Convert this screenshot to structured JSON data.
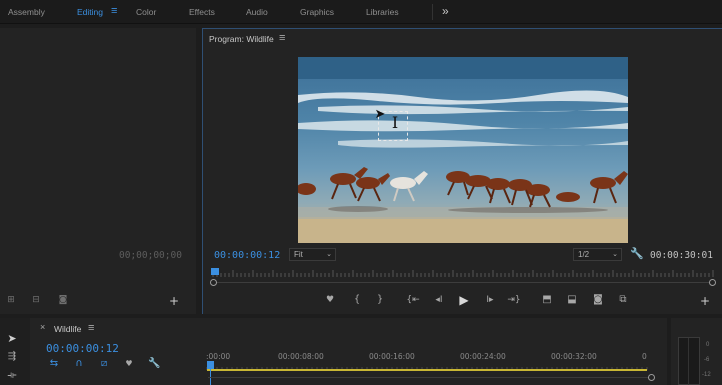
{
  "workspaces": {
    "tabs": [
      {
        "label": "Assembly"
      },
      {
        "label": "Editing"
      },
      {
        "label": "Color"
      },
      {
        "label": "Effects"
      },
      {
        "label": "Audio"
      },
      {
        "label": "Graphics"
      },
      {
        "label": "Libraries"
      }
    ],
    "active": "Editing",
    "menu_icon": "≡",
    "overflow_icon": "»"
  },
  "source_panel": {
    "timecode": "00;00;00;00",
    "add_icon": "+"
  },
  "program_monitor": {
    "title": "Program: Wildlife",
    "menu_icon": "≡",
    "current_timecode": "00:00:00:12",
    "fit_label": "Fit",
    "resolution_label": "1/2",
    "duration": "00:00:30:01",
    "add_icon": "+"
  },
  "timeline": {
    "close_icon": "×",
    "sequence_name": "Wildlife",
    "menu_icon": "≡",
    "timecode": "00:00:00:12",
    "ruler_labels": [
      ":00:00",
      "00:00:08:00",
      "00:00:16:00",
      "00:00:24:00",
      "00:00:32:00",
      "0"
    ],
    "playhead_fraction": 0.003
  },
  "audio_meter": {
    "scale_labels": [
      "0",
      "-6",
      "-12"
    ]
  },
  "colors": {
    "accent": "#3b8fe0",
    "panel": "#232323",
    "background": "#1d1d1d"
  }
}
